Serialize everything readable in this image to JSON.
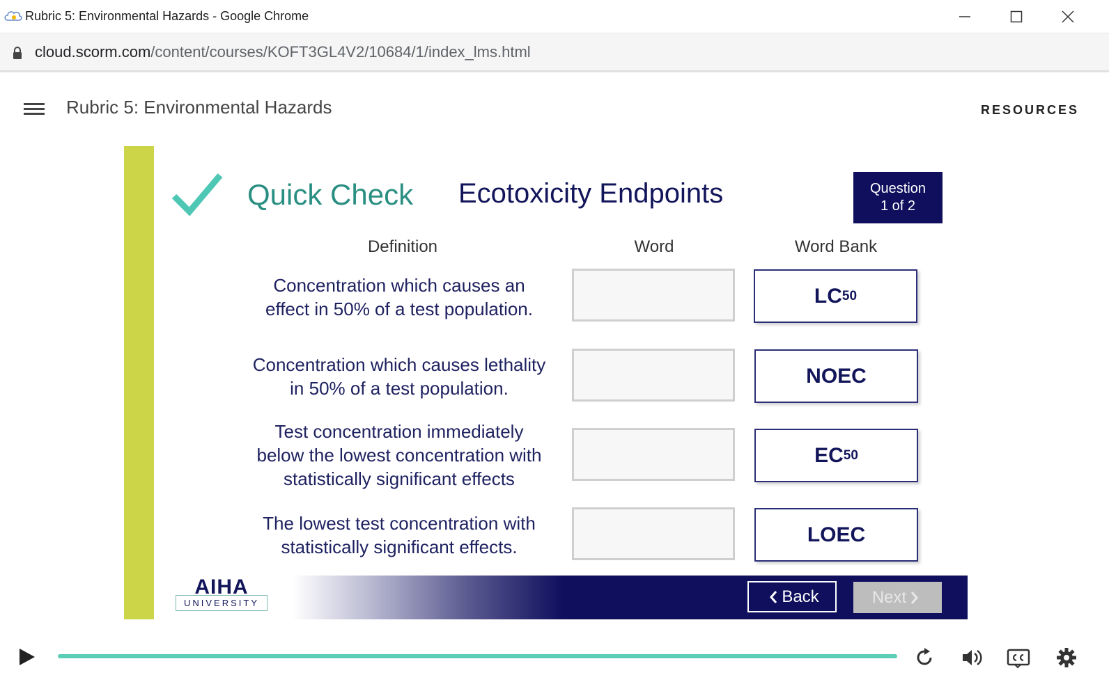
{
  "browser": {
    "window_title": "Rubric 5: Environmental Hazards - Google Chrome",
    "url_domain": "cloud.scorm.com",
    "url_path": "/content/courses/KOFT3GL4V2/10684/1/index_lms.html"
  },
  "course": {
    "title": "Rubric 5: Environmental Hazards",
    "resources_label": "RESOURCES"
  },
  "slide": {
    "quick_check": "Quick Check",
    "title": "Ecotoxicity Endpoints",
    "question_badge": {
      "line1": "Question",
      "line2": "1 of 2"
    },
    "columns": {
      "definition": "Definition",
      "word": "Word",
      "word_bank": "Word Bank"
    },
    "definitions": [
      {
        "line1": "Concentration which causes an",
        "line2": "effect in 50% of a test population."
      },
      {
        "line1": "Concentration which causes lethality",
        "line2": "in 50% of a test population."
      },
      {
        "line1": "Test concentration immediately",
        "line2": "below the lowest concentration with",
        "line3": "statistically significant effects"
      },
      {
        "line1": "The lowest test concentration with",
        "line2": "statistically significant effects."
      }
    ],
    "word_bank": [
      {
        "main": "LC",
        "sub": "50"
      },
      {
        "main": "NOEC",
        "sub": ""
      },
      {
        "main": "EC",
        "sub": "50"
      },
      {
        "main": "LOEC",
        "sub": ""
      }
    ]
  },
  "footer": {
    "logo_main": "AIHA",
    "logo_sub": "UNIVERSITY",
    "back_label": "Back",
    "next_label": "Next"
  },
  "player": {
    "progress": 1.0,
    "accent_color": "#5ccdb7",
    "controls": [
      "play-icon",
      "replay-icon",
      "volume-icon",
      "closed-captions-icon",
      "gear-icon"
    ]
  }
}
